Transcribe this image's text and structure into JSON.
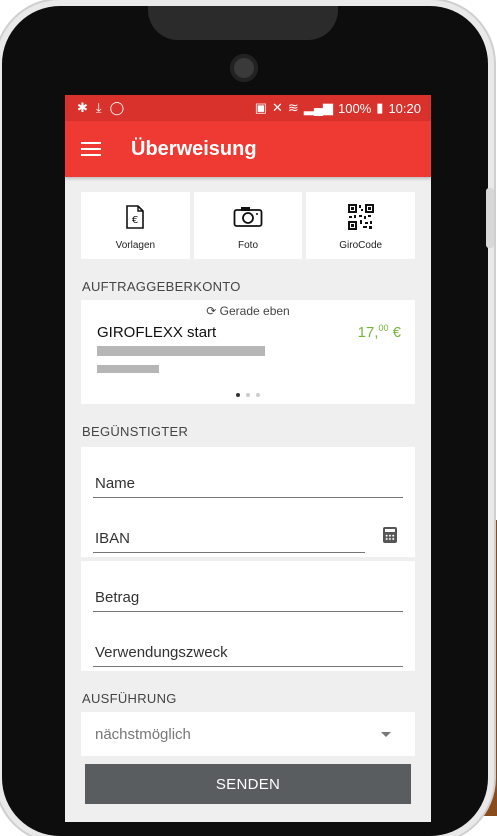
{
  "status": {
    "battery": "100%",
    "time": "10:20"
  },
  "appbar": {
    "title": "Überweisung"
  },
  "quick_actions": [
    {
      "label": "Vorlagen",
      "icon": "document-euro-icon"
    },
    {
      "label": "Foto",
      "icon": "camera-icon"
    },
    {
      "label": "GiroCode",
      "icon": "qr-code-icon"
    }
  ],
  "sender": {
    "section_label": "AUFTRAGGEBERKONTO",
    "sync_text": "Gerade eben",
    "account_name": "GIROFLEXX start",
    "balance_main": "17,",
    "balance_cents": "00",
    "balance_currency": " €",
    "balance_color": "#77b53a"
  },
  "recipient": {
    "section_label": "BEGÜNSTIGTER",
    "name_label": "Name",
    "iban_label": "IBAN",
    "amount_label": "Betrag",
    "purpose_label": "Verwendungszweck"
  },
  "execution": {
    "section_label": "AUSFÜHRUNG",
    "selected": "nächstmöglich"
  },
  "send_button": "SENDEN",
  "colors": {
    "appbar": "#ee3a32",
    "statusbar": "#d9312b",
    "button": "#5a5d5f"
  }
}
